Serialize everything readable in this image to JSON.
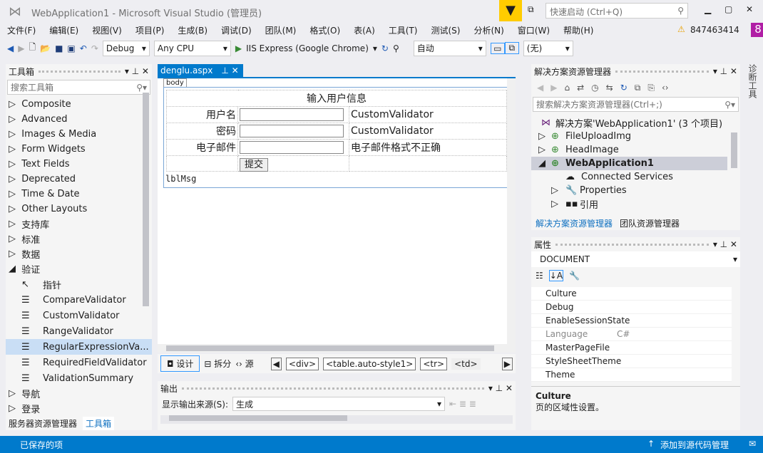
{
  "title": "WebApplication1 - Microsoft Visual Studio (管理员)",
  "quick_launch_placeholder": "快速启动 (Ctrl+Q)",
  "menu": [
    "文件(F)",
    "编辑(E)",
    "视图(V)",
    "项目(P)",
    "生成(B)",
    "调试(D)",
    "团队(M)",
    "格式(O)",
    "表(A)",
    "工具(T)",
    "测试(S)",
    "分析(N)",
    "窗口(W)",
    "帮助(H)"
  ],
  "account": "847463414",
  "notif_count": "8",
  "toolbar": {
    "config": "Debug",
    "platform": "Any CPU",
    "run": "IIS Express (Google Chrome)",
    "zoom": "自动",
    "style": "(无)"
  },
  "toolbox": {
    "title": "工具箱",
    "search_placeholder": "搜索工具箱",
    "groups": [
      "Composite",
      "Advanced",
      "Images & Media",
      "Form Widgets",
      "Text Fields",
      "Deprecated",
      "Time & Date",
      "Other Layouts",
      "支持库",
      "标准",
      "数据"
    ],
    "open_group": "验证",
    "items": [
      "指针",
      "CompareValidator",
      "CustomValidator",
      "RangeValidator",
      "RegularExpressionVa...",
      "RequiredFieldValidator",
      "ValidationSummary"
    ],
    "after": [
      "导航",
      "登录"
    ],
    "tabs": [
      "服务器资源管理器",
      "工具箱"
    ]
  },
  "editor": {
    "tab": "denglu.aspx",
    "body_tag": "body",
    "heading": "输入用户信息",
    "rows": [
      {
        "label": "用户名",
        "validator": "CustomValidator"
      },
      {
        "label": "密码",
        "validator": "CustomValidator"
      },
      {
        "label": "电子邮件",
        "validator": "电子邮件格式不正确"
      }
    ],
    "submit": "提交",
    "lbl": "lblMsg",
    "views": [
      "设计",
      "拆分",
      "源"
    ],
    "crumbs": [
      "<div>",
      "<table.auto-style1>",
      "<tr>",
      "<td>"
    ]
  },
  "output": {
    "title": "输出",
    "source_label": "显示输出来源(S):",
    "source": "生成"
  },
  "solution": {
    "title": "解决方案资源管理器",
    "search_placeholder": "搜索解决方案资源管理器(Ctrl+;)",
    "root": "解决方案'WebApplication1' (3 个项目)",
    "items": [
      "FileUploadImg",
      "HeadImage",
      "WebApplication1",
      "Connected Services",
      "Properties",
      "引用"
    ],
    "tabs": [
      "解决方案资源管理器",
      "团队资源管理器"
    ]
  },
  "properties": {
    "title": "属性",
    "object": "DOCUMENT",
    "rows": [
      {
        "k": "Culture",
        "v": ""
      },
      {
        "k": "Debug",
        "v": ""
      },
      {
        "k": "EnableSessionState",
        "v": ""
      },
      {
        "k": "Language",
        "v": "C#"
      },
      {
        "k": "MasterPageFile",
        "v": ""
      },
      {
        "k": "StyleSheetTheme",
        "v": ""
      },
      {
        "k": "Theme",
        "v": ""
      }
    ],
    "desc_title": "Culture",
    "desc": "页的区域性设置。"
  },
  "side_tab": "诊断工具",
  "status": {
    "left": "已保存的项",
    "right": "添加到源代码管理"
  }
}
